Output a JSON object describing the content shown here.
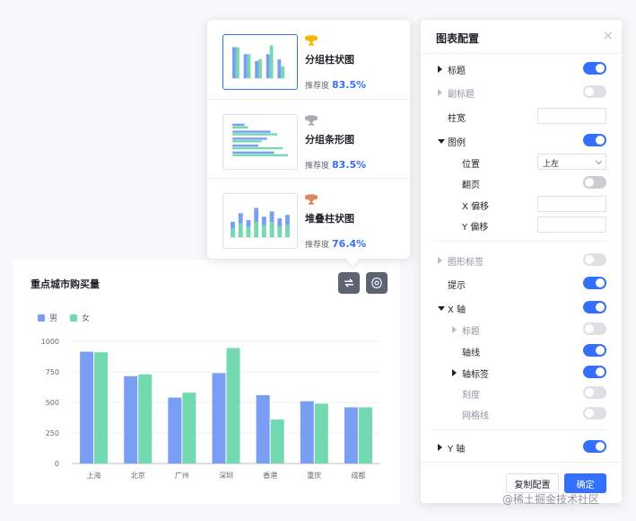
{
  "chart": {
    "title": "重点城市购买量",
    "colors": {
      "series1": "#7b9ef5",
      "series2": "#72d9b0"
    }
  },
  "chart_data": {
    "type": "bar",
    "categories": [
      "上海",
      "北京",
      "广州",
      "深圳",
      "香港",
      "重庆",
      "成都"
    ],
    "series": [
      {
        "name": "男",
        "values": [
          915,
          715,
          540,
          740,
          560,
          510,
          460
        ]
      },
      {
        "name": "女",
        "values": [
          910,
          730,
          580,
          945,
          360,
          490,
          460
        ]
      }
    ],
    "yticks": [
      "0",
      "250",
      "500",
      "750",
      "1000"
    ],
    "ylim": [
      0,
      1000
    ],
    "grid": true,
    "legend": "top-left"
  },
  "recommendations": [
    {
      "name": "分组柱状图",
      "score_label": "推荐度",
      "score": "83.5%",
      "trophy": "gold-trophy-icon",
      "trophy_color": "#f5b800",
      "selected": true
    },
    {
      "name": "分组条形图",
      "score_label": "推荐度",
      "score": "83.5%",
      "trophy": "silver-trophy-icon",
      "trophy_color": "#a8adb5",
      "selected": false
    },
    {
      "name": "堆叠柱状图",
      "score_label": "推荐度",
      "score": "76.4%",
      "trophy": "bronze-trophy-icon",
      "trophy_color": "#d9895a",
      "selected": false
    }
  ],
  "config": {
    "title": "图表配置",
    "close": "×",
    "rows": [
      {
        "key": "title",
        "label": "标题",
        "arrow": "right",
        "control": "toggle",
        "on": true,
        "disabled": false
      },
      {
        "key": "subtitle",
        "label": "副标题",
        "arrow": "right",
        "control": "toggle",
        "on": false,
        "disabled": true
      },
      {
        "key": "bar_width",
        "label": "柱宽",
        "arrow": "none",
        "control": "input",
        "value": ""
      },
      {
        "key": "legend",
        "label": "图例",
        "arrow": "down",
        "control": "toggle",
        "on": true,
        "disabled": false
      },
      {
        "key": "legend_position",
        "label": "位置",
        "arrow": "none",
        "indent": true,
        "control": "select",
        "value": "上左"
      },
      {
        "key": "legend_paging",
        "label": "翻页",
        "arrow": "none",
        "indent": true,
        "control": "toggle",
        "on": false,
        "disabled": false
      },
      {
        "key": "legend_x_offset",
        "label": "X 偏移",
        "arrow": "none",
        "indent": true,
        "control": "input",
        "value": ""
      },
      {
        "key": "legend_y_offset",
        "label": "Y 偏移",
        "arrow": "none",
        "indent": true,
        "control": "input",
        "value": ""
      },
      {
        "key": "shape_label",
        "label": "图形标签",
        "arrow": "right",
        "control": "toggle",
        "on": false,
        "disabled": true
      },
      {
        "key": "tooltip",
        "label": "提示",
        "arrow": "none",
        "control": "toggle",
        "on": true,
        "disabled": false
      },
      {
        "key": "x_axis",
        "label": "X 轴",
        "arrow": "down",
        "control": "toggle",
        "on": true,
        "disabled": false
      },
      {
        "key": "x_axis_title",
        "label": "标题",
        "arrow": "right",
        "indent": true,
        "control": "toggle",
        "on": false,
        "disabled": true
      },
      {
        "key": "x_axis_line",
        "label": "轴线",
        "arrow": "none",
        "indent": true,
        "control": "toggle",
        "on": true,
        "disabled": false
      },
      {
        "key": "x_axis_label",
        "label": "轴标签",
        "arrow": "right",
        "indent": true,
        "control": "toggle",
        "on": true,
        "disabled": false
      },
      {
        "key": "x_axis_tick",
        "label": "刻度",
        "arrow": "none",
        "indent": true,
        "control": "toggle",
        "on": false,
        "disabled": true
      },
      {
        "key": "x_axis_grid",
        "label": "网格线",
        "arrow": "none",
        "indent": true,
        "control": "toggle",
        "on": false,
        "disabled": true
      },
      {
        "key": "y_axis",
        "label": "Y 轴",
        "arrow": "right",
        "control": "toggle",
        "on": true,
        "disabled": false
      }
    ],
    "copy_button": "复制配置",
    "ok_button": "确定"
  },
  "watermark": "@稀土掘金技术社区"
}
